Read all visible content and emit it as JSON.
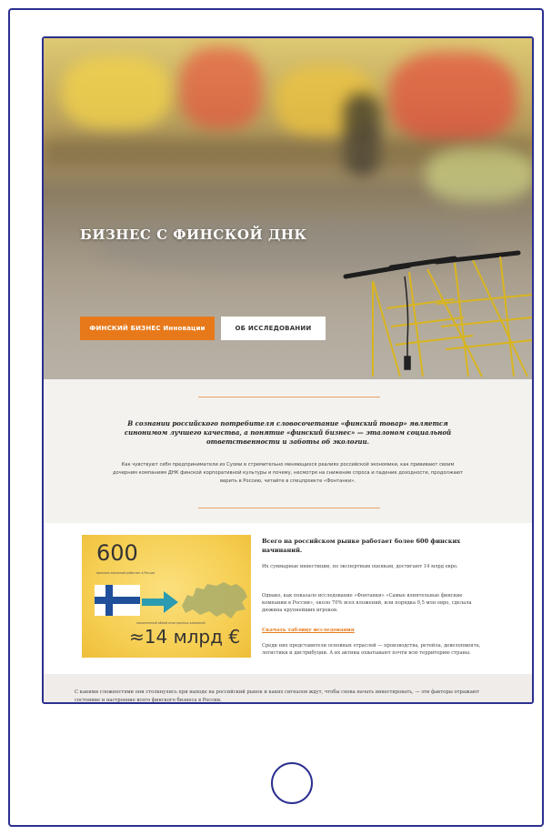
{
  "hero": {
    "title": "БИЗНЕС С ФИНСКОЙ ДНК",
    "primary_button": "ФИНСКИЙ БИЗНЕС Инновации",
    "secondary_button": "ОБ ИССЛЕДОВАНИИ"
  },
  "intro": {
    "lead": "В сознании российского потребителя словосочетание «финский товар» является синонимом лучшего качества, а понятие «финский бизнес» — эталоном социальной ответственности и заботы об экологии.",
    "body": "Как чувствуют себя предприниматели из Суоми в стремительно меняющихся реалиях российской экономики, как прививают своим дочерним компаниям ДНК финской корпоративной культуры и почему, несмотря на снижение спроса и падение доходности, продолжают верить в Россию, читайте в спецпроекте «Фонтанки»."
  },
  "feature": {
    "infographic": {
      "stat_companies": "600",
      "stat_companies_caption": "финских компаний работает в России",
      "stat_volume_caption": "накопленный объём иностранных вложений",
      "stat_volume": "≈14 млрд €"
    },
    "heading": "Всего на российском рынке работает более 600 финских начинаний.",
    "p1": "Их суммарные инвестиции, по экспертным оценкам, достигают 14 млрд евро.",
    "p2": "Однако, как показало исследование «Фонтанки» «Самые влиятельные финские компании в России», около 70% всех вложений, или порядка 9,5 млн евро, сделала дюжина крупнейших игроков.",
    "link": "Скачать таблицу исследования",
    "p3": "Среди них представители основных отраслей — производства, ретейла, девелопмента, логистики и дистрибуции. А их активы охватывают почти всю территорию страны."
  },
  "bottom": {
    "text": "С какими сложностями они столкнулись при выходе на российский рынок и каких сигналов ждут, чтобы снова начать инвестировать, — эти факторы отражают состояние и настроение всего финского бизнеса в России."
  },
  "colors": {
    "accent": "#e8791a",
    "frame": "#2b2f8f",
    "flag_blue": "#1f4f9a",
    "infographic_bg": "#f6cf54"
  }
}
